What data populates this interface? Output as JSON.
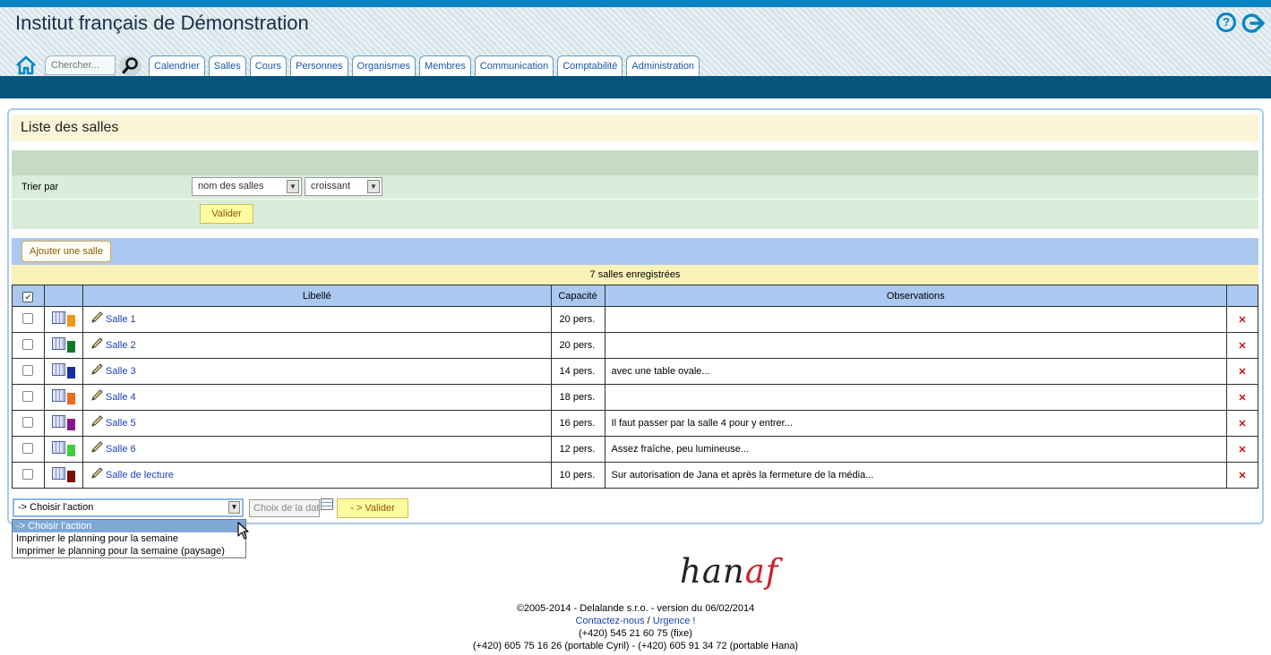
{
  "app": {
    "title": "Institut français de Démonstration"
  },
  "search": {
    "placeholder": "Chercher..."
  },
  "nav": {
    "tabs": [
      "Calendrier",
      "Salles",
      "Cours",
      "Personnes",
      "Organismes",
      "Membres",
      "Communication",
      "Comptabilité",
      "Administration"
    ]
  },
  "page": {
    "title": "Liste des salles"
  },
  "filter": {
    "label": "Trier par",
    "sort_field": "nom des salles",
    "sort_order": "croissant",
    "validate": "Valider"
  },
  "add_button": "Ajouter une salle",
  "count_text": "7 salles enregistrées",
  "table": {
    "headers": {
      "label": "Libellé",
      "capacity": "Capacité",
      "observations": "Observations"
    },
    "rows": [
      {
        "name": "Salle 1",
        "color": "#f39419",
        "capacity": "20 pers.",
        "observations": ""
      },
      {
        "name": "Salle 2",
        "color": "#0f7a26",
        "capacity": "20 pers.",
        "observations": ""
      },
      {
        "name": "Salle 3",
        "color": "#1a2fa0",
        "capacity": "14 pers.",
        "observations": "avec une table ovale..."
      },
      {
        "name": "Salle 4",
        "color": "#ee6a1c",
        "capacity": "18 pers.",
        "observations": ""
      },
      {
        "name": "Salle 5",
        "color": "#8a1590",
        "capacity": "16 pers.",
        "observations": "Il faut passer par la salle 4 pour y entrer..."
      },
      {
        "name": "Salle 6",
        "color": "#3ed13a",
        "capacity": "12 pers.",
        "observations": "Assez fraîche, peu lumineuse..."
      },
      {
        "name": "Salle de lecture",
        "color": "#7a0c0c",
        "capacity": "10 pers.",
        "observations": "Sur autorisation de Jana et après la fermeture de la média..."
      }
    ]
  },
  "actions": {
    "selected": "-> Choisir l'action",
    "options": [
      "-> Choisir l'action",
      "Imprimer le planning pour la semaine",
      "Imprimer le planning pour la semaine (paysage)"
    ],
    "date_placeholder": "Choix de la date",
    "validate": "- > Valider"
  },
  "footer": {
    "logo_main": "han",
    "logo_accent": "af",
    "copyright": "©2005-2014 - Delalande s.r.o. - version du 06/02/2014",
    "contact": "Contactez-nous",
    "separator": " / ",
    "urgent": "Urgence !",
    "phone_fixed": "(+420) 545 21 60 75 (fixe)",
    "phones_mobile": "(+420) 605 75 16 26 (portable Cyril) - (+420) 605 91 34 72 (portable Hana)"
  },
  "icons": {
    "help": "help-icon",
    "logout": "logout-icon",
    "home": "home-icon",
    "search": "search-icon",
    "calendar": "calendar-icon",
    "edit": "pencil-icon",
    "delete": "delete-icon"
  }
}
